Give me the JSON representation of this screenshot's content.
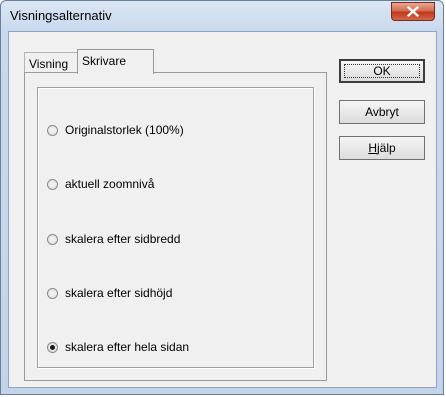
{
  "window": {
    "title": "Visningsalternativ",
    "close_icon": "close-x-icon"
  },
  "tabs": [
    {
      "label": "Visning",
      "active": false
    },
    {
      "label": "Skrivare",
      "active": true
    }
  ],
  "options": [
    {
      "label": "Originalstorlek (100%)",
      "checked": false
    },
    {
      "label": "aktuell zoomnivå",
      "checked": false
    },
    {
      "label": "skalera efter sidbredd",
      "checked": false
    },
    {
      "label": "skalera efter sidhöjd",
      "checked": false
    },
    {
      "label": "skalera efter hela sidan",
      "checked": true
    }
  ],
  "buttons": {
    "ok": "OK",
    "cancel": "Avbryt",
    "help_accel": "H",
    "help_rest": "jälp"
  },
  "colors": {
    "close_button": "#c0391c",
    "dialog_face": "#f0f0f0",
    "frame": "#c3d4ea"
  }
}
